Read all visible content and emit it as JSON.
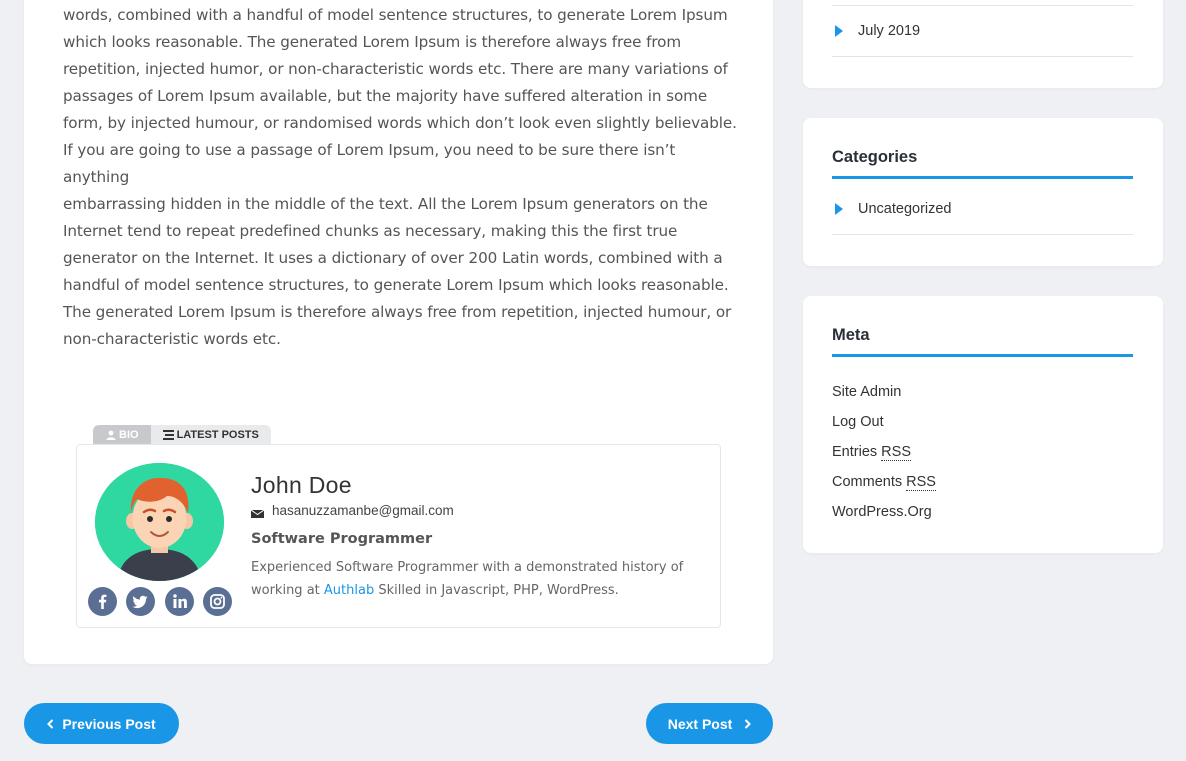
{
  "post": {
    "lines": [
      "words, combined with a handful of model sentence structures, to generate Lorem Ipsum",
      "which looks reasonable. The generated Lorem Ipsum is therefore always free from",
      "repetition, injected humor, or non-characteristic words etc. There are many variations of",
      "passages of Lorem Ipsum available, but the majority have suffered alteration in some",
      "form, by injected humour, or randomised words which don’t look even slightly believable.",
      "If you are going to use a passage of Lorem Ipsum, you need to be sure there isn’t anything",
      "embarrassing hidden in the middle of the text. All the Lorem Ipsum generators on the",
      "Internet tend to repeat predefined chunks as necessary, making this the first true",
      "generator on the Internet. It uses a dictionary of over 200 Latin words, combined with a",
      "handful of model sentence structures, to generate Lorem Ipsum which looks reasonable.",
      "The generated Lorem Ipsum is therefore always free from repetition, injected humour, or",
      "non-characteristic words etc."
    ]
  },
  "author": {
    "tab_bio": "BIO",
    "tab_latest": "LATEST POSTS",
    "name": "John Doe",
    "email": "hasanuzzamanbe@gmail.com",
    "role": "Software Programmer",
    "desc_before": "Experienced Software Programmer with a demonstrated history of working at ",
    "desc_link": "Authlab",
    "desc_after": " Skilled in Javascript,  PHP, WordPress.",
    "social_icons": [
      "facebook-icon",
      "twitter-icon",
      "linkedin-icon",
      "instagram-icon"
    ]
  },
  "nav": {
    "prev": "Previous Post",
    "next": "Next Post"
  },
  "sidebar": {
    "archives": [
      {
        "label": "July 2019"
      }
    ],
    "categories_title": "Categories",
    "categories": [
      {
        "label": "Uncategorized"
      }
    ],
    "meta_title": "Meta",
    "meta": {
      "site_admin": "Site Admin",
      "log_out": "Log Out",
      "entries": "Entries",
      "comments": "Comments",
      "rss": "RSS",
      "wordpress": "WordPress.Org"
    }
  },
  "colors": {
    "accent": "#1a96e6",
    "avatar_bg": "#2fd8a0",
    "social_bg": "#5b6f95"
  }
}
